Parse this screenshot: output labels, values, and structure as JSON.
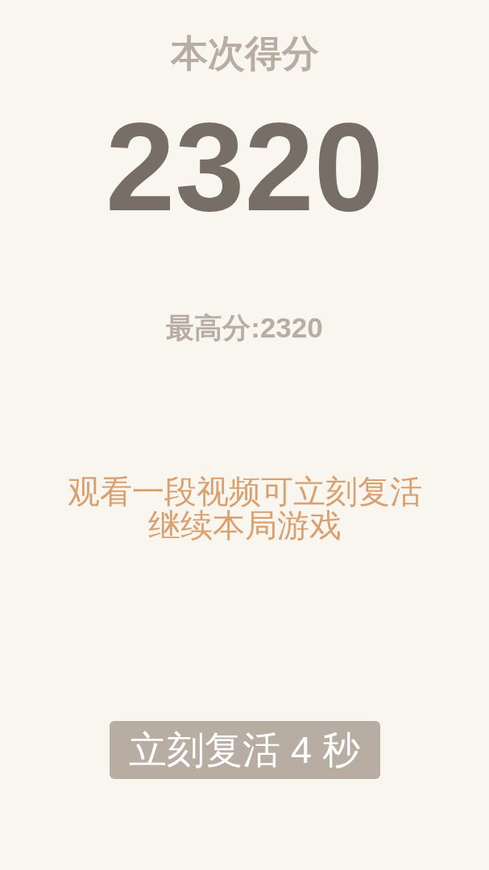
{
  "title": "本次得分",
  "score": "2320",
  "best_score": "最高分:2320",
  "message": [
    "观看一段视频可立刻复活",
    "继续本局游戏"
  ],
  "revive_button": {
    "label": "立刻复活 4 秒"
  }
}
